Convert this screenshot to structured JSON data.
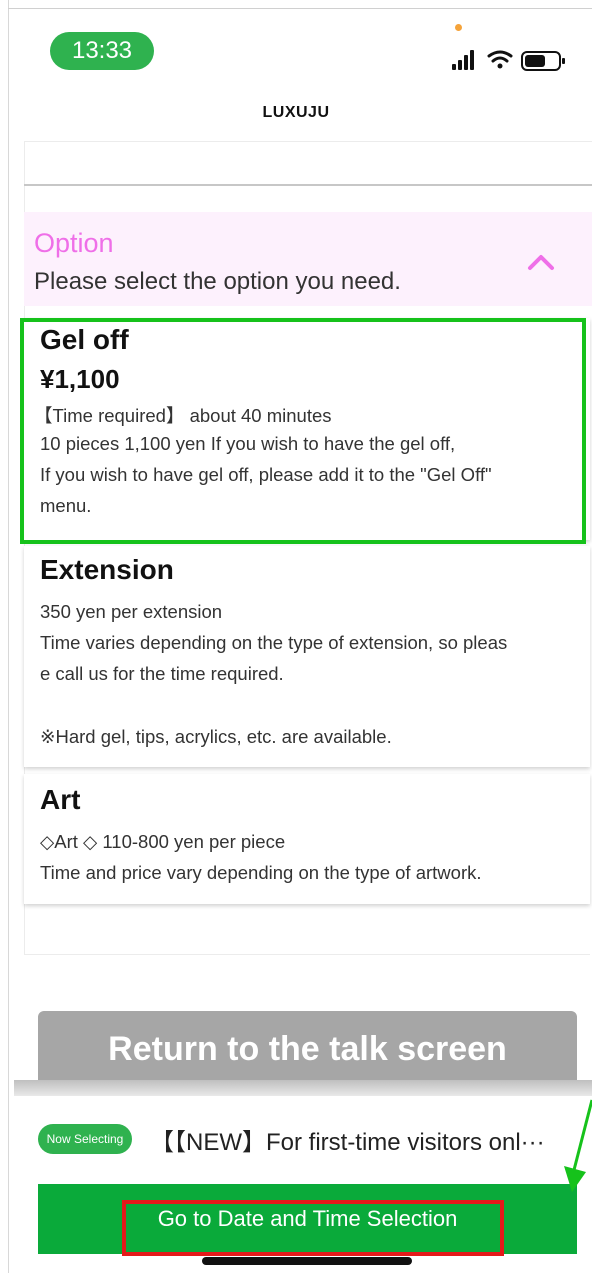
{
  "status_bar": {
    "time": "13:33",
    "icons": [
      "signal-icon",
      "wifi-icon",
      "battery-icon"
    ]
  },
  "header": {
    "title": "LUXUJU"
  },
  "option_section": {
    "title": "Option",
    "subtitle": "Please select the option you need.",
    "accent_color": "#ef6fe8",
    "background_color": "#fdf1fd",
    "collapse_icon": "chevron-up-icon"
  },
  "options": [
    {
      "title": "Gel off",
      "price": "¥1,100",
      "lines": [
        "【Time required】 about 40 minutes",
        "10 pieces 1,100 yen If you wish to have the gel off,",
        "If you wish to have gel off, please add it to the \"Gel Off\"",
        "menu."
      ]
    },
    {
      "title": "Extension",
      "lines": [
        "350 yen per extension",
        "Time varies depending on the type of extension, so pleas",
        "e call us for the time required.",
        "",
        "※Hard gel, tips, acrylics, etc. are available."
      ]
    },
    {
      "title": "Art",
      "lines": [
        "◇Art ◇ 110-800 yen per piece",
        "Time and price vary depending on the type of artwork."
      ]
    }
  ],
  "return_button": {
    "label": "Return to the talk screen"
  },
  "selection_bar": {
    "badge": "Now Selecting",
    "selected_text": "【【NEW】For first-time visitors onl···"
  },
  "go_button": {
    "label": "Go to Date and Time Selection",
    "color": "#0aaa3a"
  },
  "annotation_colors": {
    "green_box": "#16c21b",
    "red_box": "#e41a1a"
  }
}
